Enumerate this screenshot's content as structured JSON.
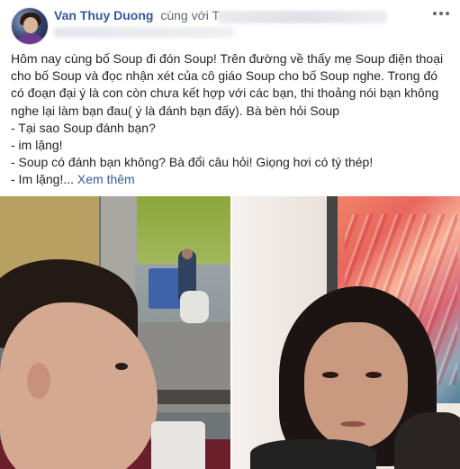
{
  "header": {
    "author_name": "Van Thuy Duong",
    "with_text": "cùng với T"
  },
  "post": {
    "lines": [
      "Hôm nay cùng bố Soup đi đón Soup! Trên đường về thấy mẹ Soup điện thoại",
      "cho bố Soup và đọc nhận xét của cô giáo Soup cho bố Soup nghe. Trong đó",
      "có đoạn đại ý là con còn chưa kết hợp với các bạn, thi thoảng nói bạn không",
      "nghe lại làm bạn đau( ý là đánh bạn đấy). Bà bèn hỏi Soup",
      "- Tại sao Soup đánh bạn?",
      "- im lặng!",
      "- Soup có đánh bạn không? Bà đổi câu hỏi! Giọng hơi có tý thép!"
    ],
    "last_line": "- Im lặng!...",
    "see_more": "Xem thêm"
  },
  "icons": {
    "more": "more-horizontal-icon"
  }
}
